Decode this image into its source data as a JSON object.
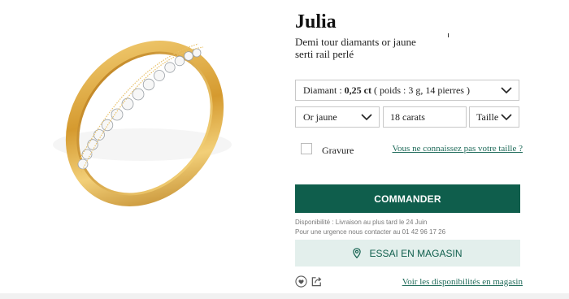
{
  "product": {
    "title": "Julia",
    "subtitle": "Demi tour diamants or jaune serti rail perlé"
  },
  "options": {
    "diamant_label": "Diamant :",
    "diamant_value": "0,25 ct",
    "diamant_details": "( poids : 3 g, 14 pierres )",
    "metal": "Or jaune",
    "carats": "18 carats",
    "taille": "Taille"
  },
  "engraving": {
    "label": "Gravure"
  },
  "links": {
    "size": "Vous ne connaissez pas votre taille ?",
    "availability": "Voir les disponibilités en magasin"
  },
  "actions": {
    "order": "COMMANDER",
    "store_trial": "ESSAI EN MAGASIN"
  },
  "availability": {
    "line1": "Disponibilité : Livraison au plus tard le 24 Juin",
    "line2": "Pour une urgence nous contacter au 01 42 96 17 26"
  },
  "icons": [
    "heart-icon",
    "share-icon",
    "chevron-down-icon",
    "location-pin-icon"
  ],
  "colors": {
    "accent": "#0f5e4c",
    "secondary_bg": "#e3efec",
    "link": "#1f6b5a",
    "gold": "#d9a640"
  }
}
